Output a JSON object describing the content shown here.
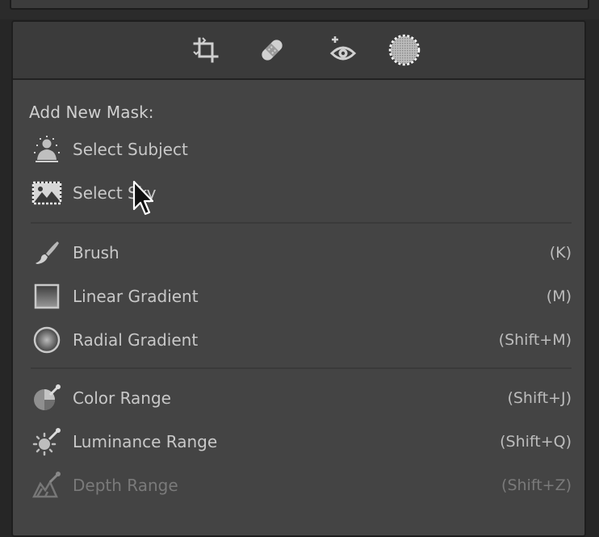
{
  "toolbar": {
    "tools": [
      {
        "icon": "crop-icon"
      },
      {
        "icon": "healing-bandage-icon"
      },
      {
        "icon": "red-eye-icon"
      },
      {
        "icon": "masking-icon",
        "active": true
      }
    ]
  },
  "mask_menu": {
    "title": "Add New Mask:",
    "ai_items": [
      {
        "label": "Select Subject",
        "icon": "select-subject-icon"
      },
      {
        "label": "Select Sky",
        "icon": "select-sky-icon"
      }
    ],
    "tool_items": [
      {
        "label": "Brush",
        "shortcut": "(K)",
        "icon": "brush-icon"
      },
      {
        "label": "Linear Gradient",
        "shortcut": "(M)",
        "icon": "linear-gradient-icon"
      },
      {
        "label": "Radial Gradient",
        "shortcut": "(Shift+M)",
        "icon": "radial-gradient-icon"
      }
    ],
    "range_items": [
      {
        "label": "Color Range",
        "shortcut": "(Shift+J)",
        "icon": "color-range-icon"
      },
      {
        "label": "Luminance Range",
        "shortcut": "(Shift+Q)",
        "icon": "luminance-range-icon"
      },
      {
        "label": "Depth Range",
        "shortcut": "(Shift+Z)",
        "icon": "depth-range-icon",
        "disabled": true
      }
    ]
  },
  "colors": {
    "panel_bg": "#444444",
    "toolbar_bg": "#3b3b3b",
    "text": "#c8c8c8",
    "disabled_text": "#7a7a7a"
  }
}
